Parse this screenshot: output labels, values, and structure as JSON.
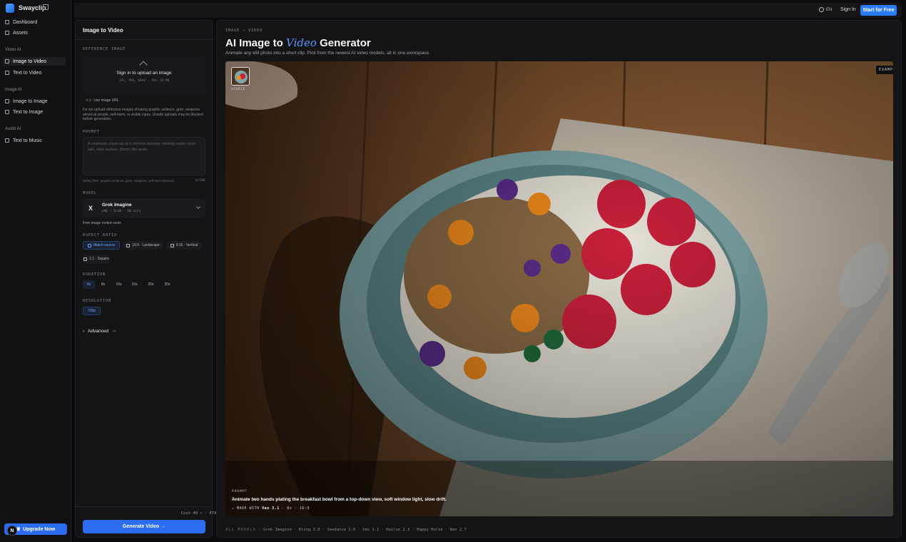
{
  "brand": {
    "name": "Swayclip"
  },
  "sidebar": {
    "dashboard": "Dashboard",
    "assets": "Assets",
    "video_group": "Video AI",
    "image_to_video": "Image to Video",
    "text_to_video": "Text to Video",
    "image_group": "Image AI",
    "image_to_image": "Image to Image",
    "text_to_image": "Text to Image",
    "audio_group": "Audio AI",
    "text_to_music": "Text to Music",
    "upgrade": "Upgrade Now",
    "avatar_letter": "N"
  },
  "topbar": {
    "lang": "EN",
    "signin": "Sign In",
    "start": "Start for Free"
  },
  "panel": {
    "title": "Image to Video",
    "ref_label": "REFERENCE IMAGE",
    "upload_title": "Sign in to upload an image",
    "upload_sub": "JPG, PNG, WebP · Max 10 MB",
    "use_url": "Use image URL",
    "warning": "Do not upload reference images showing graphic violence, gore, weapons aimed at people, self-harm, or visible injury. Unsafe uploads may be blocked before generation.",
    "prompt_label": "PROMPT",
    "prompt_placeholder": "A cinematic close-up of a chrome sneaker rotating under neon rain, slow motion, 35mm film grain.",
    "safety": "Safety filter: graphic violence, gore, weapons, self-harm blocked.",
    "count": "0/500",
    "model_label": "MODEL",
    "model_name": "Grok Imagine",
    "model_meta": "xAI · Grok · 10 cr/s",
    "model_free": "Free image motion tests",
    "aspect_label": "ASPECT RATIO",
    "aspect": [
      "Match source",
      "16:9 · Landscape",
      "9:16 · Vertical",
      "1:1 · Square"
    ],
    "duration_label": "DURATION",
    "durations": [
      "4s",
      "8s",
      "10s",
      "15s",
      "20s",
      "30s"
    ],
    "resolution_label": "RESOLUTION",
    "resolution": "720p",
    "advanced": "Advanced",
    "advanced_count": "+0",
    "cost": "Cost 40 ⚡ · ETA ~90s",
    "generate": "Generate Video →"
  },
  "main": {
    "crumb": "IMAGE → VIDEO",
    "title_a": "AI Image to ",
    "title_b": "Video",
    "title_c": " Generator",
    "subtitle": "Animate any still photo into a short clip. Pick from the newest AI video models, all in one workspace.",
    "example_tag": "EXAMPLE",
    "thumb_label": "SOURCE",
    "prompt_label": "PROMPT",
    "prompt_text": "Animate two hands plating the breakfast bowl from a top-down view, soft window light, slow drift.",
    "made_with": "MADE WITH",
    "made_model": "Veo 3.1",
    "made_dur": "8s",
    "made_ratio": "16:9",
    "models_label": "ALL MODELS",
    "models": "Grok Imagine · Kling 3.0 · Seedance 2.0 · Veo 3.1 · Hailuo 2.3 · Happy Horse · Wan 2.7"
  },
  "colors": {
    "accent": "#2b6cf0",
    "background": "#0c0c0e",
    "panel": "#141417"
  }
}
